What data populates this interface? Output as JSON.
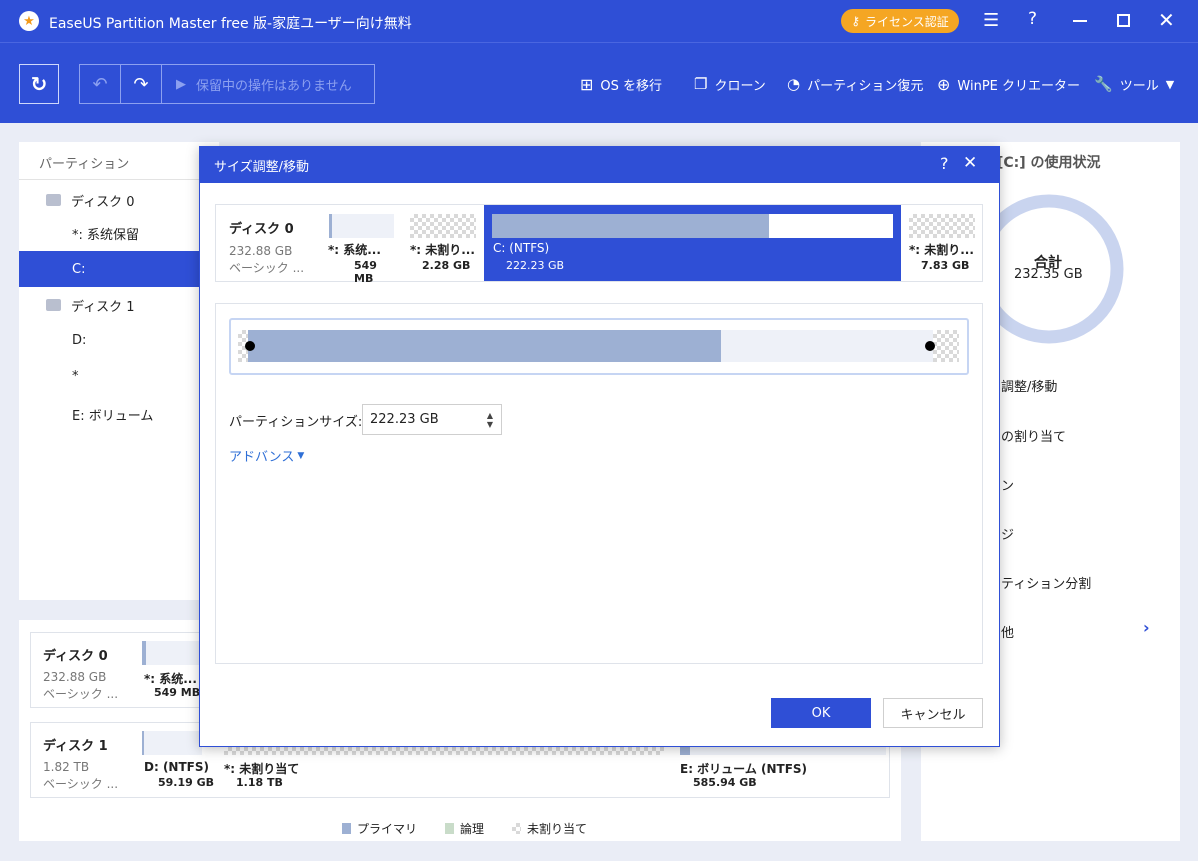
{
  "app": {
    "title": "EaseUS Partition Master free 版-家庭ユーザー向け無料",
    "license_label": "ライセンス認証"
  },
  "toolbar": {
    "pending_label": "保留中の操作はありません",
    "items": [
      {
        "label": "OS を移行"
      },
      {
        "label": "クローン"
      },
      {
        "label": "パーティション復元"
      },
      {
        "label": "WinPE クリエーター"
      },
      {
        "label": "ツール"
      }
    ]
  },
  "sidebar": {
    "header": "パーティション",
    "items": [
      {
        "label": "ディスク 0"
      },
      {
        "label": "*: 系统保留"
      },
      {
        "label": "C:"
      },
      {
        "label": "ディスク 1"
      },
      {
        "label": "D:"
      },
      {
        "label": "*"
      },
      {
        "label": "E: ボリューム"
      }
    ]
  },
  "right_panel": {
    "title": "[C:] の使用状況",
    "total_label": "合計",
    "total_value": "232.35 GB",
    "used_fraction": 0.95,
    "actions": [
      {
        "label": "調整/移動"
      },
      {
        "label": "の割り当て"
      },
      {
        "label": "ン"
      },
      {
        "label": "ジ"
      },
      {
        "label": "ティション分割"
      },
      {
        "label": "他"
      }
    ]
  },
  "disk_map": {
    "disk0": {
      "name": "ディスク 0",
      "size": "232.88 GB",
      "type": "ベーシック ...",
      "parts": [
        {
          "name": "*: 系统...",
          "size": "549 MB"
        }
      ]
    },
    "disk1": {
      "name": "ディスク 1",
      "size": "1.82 TB",
      "type": "ベーシック ...",
      "parts": [
        {
          "name": "D: (NTFS)",
          "size": "59.19 GB"
        },
        {
          "name": "*: 未割り当て",
          "size": "1.18 TB"
        },
        {
          "name": "E: ボリューム (NTFS)",
          "size": "585.94 GB"
        }
      ]
    }
  },
  "legend": [
    {
      "label": "プライマリ",
      "color": "#9db0d3"
    },
    {
      "label": "論理",
      "color": "#c9dcc9"
    },
    {
      "label": "未割り当て",
      "color": "#dddddd"
    }
  ],
  "dialog": {
    "title": "サイズ調整/移動",
    "disk": {
      "name": "ディスク 0",
      "size": "232.88 GB",
      "type": "ベーシック ..."
    },
    "segments": [
      {
        "name": "*: 系统...",
        "size": "549 MB"
      },
      {
        "name": "*: 未割り...",
        "size": "2.28 GB"
      },
      {
        "name": "C: (NTFS)",
        "size": "222.23 GB",
        "used_fraction": 0.69
      },
      {
        "name": "*: 未割り...",
        "size": "7.83 GB"
      }
    ],
    "resize_used_fraction": 0.69,
    "size_label": "パーティションサイズ:",
    "size_value": "222.23 GB",
    "advanced_label": "アドバンス",
    "ok_label": "OK",
    "cancel_label": "キャンセル"
  }
}
